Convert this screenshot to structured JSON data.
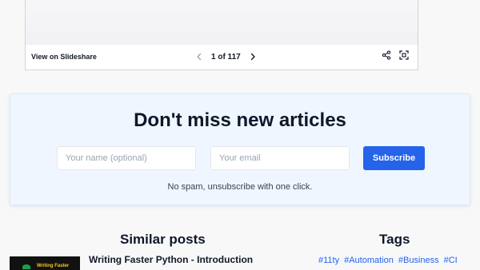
{
  "embed": {
    "view_on_label": "View on Slideshare",
    "page_current": "1",
    "page_of": "of",
    "page_total": "117",
    "page_text": "1 of 117",
    "icons": [
      "chevron-left-icon",
      "chevron-right-icon",
      "share-icon",
      "fullscreen-icon"
    ]
  },
  "newsletter": {
    "title": "Don't miss new articles",
    "name_placeholder": "Your name (optional)",
    "email_placeholder": "Your email",
    "subscribe_label": "Subscribe",
    "note": "No spam, unsubscribe with one click.",
    "accent_color": "#2563eb",
    "background_color": "#eff6ff"
  },
  "similar_posts": {
    "title": "Similar posts",
    "items": [
      {
        "title": "Writing Faster Python - Introduction",
        "thumb_text": "Writing Faster"
      }
    ]
  },
  "tags": {
    "title": "Tags",
    "items": [
      "#11ty",
      "#Automation",
      "#Business",
      "#CI"
    ]
  }
}
